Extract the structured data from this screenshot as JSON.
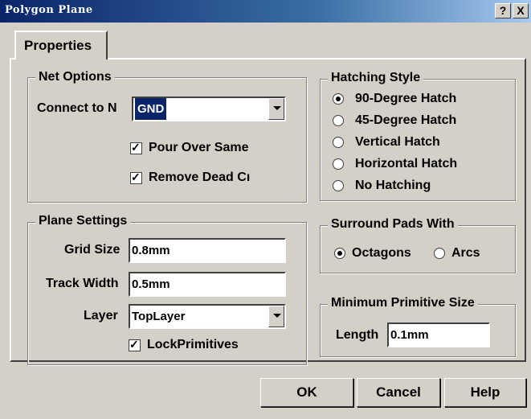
{
  "window": {
    "title": "Polygon Plane",
    "help_btn": "?",
    "close_btn": "X"
  },
  "tabs": [
    {
      "label": "Properties"
    }
  ],
  "net_options": {
    "title": "Net Options",
    "connect_label": "Connect to N",
    "connect_value": "GND",
    "pour_over_same": {
      "label": "Pour Over Same",
      "checked": true
    },
    "remove_dead": {
      "label": "Remove Dead Cı",
      "checked": true
    }
  },
  "plane_settings": {
    "title": "Plane Settings",
    "grid_size_label": "Grid Size",
    "grid_size_value": "0.8mm",
    "track_width_label": "Track Width",
    "track_width_value": "0.5mm",
    "layer_label": "Layer",
    "layer_value": "TopLayer",
    "lock_primitives": {
      "label": "LockPrimitives",
      "checked": true
    }
  },
  "hatching_style": {
    "title": "Hatching Style",
    "options": [
      {
        "label": "90-Degree Hatch",
        "selected": true
      },
      {
        "label": "45-Degree Hatch",
        "selected": false
      },
      {
        "label": "Vertical Hatch",
        "selected": false
      },
      {
        "label": "Horizontal Hatch",
        "selected": false
      },
      {
        "label": "No Hatching",
        "selected": false
      }
    ]
  },
  "surround_pads": {
    "title": "Surround Pads With",
    "options": [
      {
        "label": "Octagons",
        "selected": true
      },
      {
        "label": "Arcs",
        "selected": false
      }
    ]
  },
  "min_primitive": {
    "title": "Minimum Primitive Size",
    "length_label": "Length",
    "length_value": "0.1mm"
  },
  "buttons": {
    "ok": "OK",
    "cancel": "Cancel",
    "help": "Help"
  }
}
